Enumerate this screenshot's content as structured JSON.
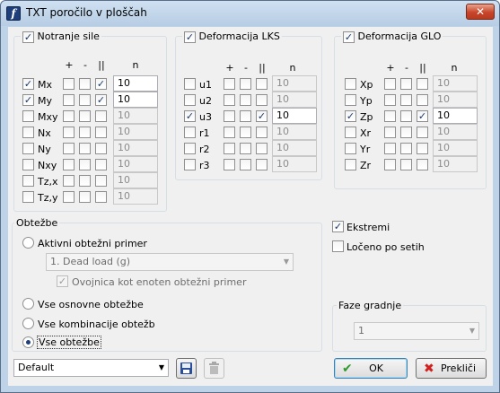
{
  "window": {
    "title": "TXT poročilo v ploščah",
    "close_glyph": "✕",
    "app_icon_glyph": "f"
  },
  "columns": {
    "plus": "+",
    "minus": "-",
    "abs": "||",
    "n": "n"
  },
  "notranje": {
    "label": "Notranje sile",
    "checked": true,
    "rows": [
      {
        "label": "Mx",
        "checked": true,
        "plus": false,
        "minus": false,
        "abs": true,
        "n": "10",
        "enabled": true
      },
      {
        "label": "My",
        "checked": true,
        "plus": false,
        "minus": false,
        "abs": true,
        "n": "10",
        "enabled": true
      },
      {
        "label": "Mxy",
        "checked": false,
        "plus": false,
        "minus": false,
        "abs": false,
        "n": "10",
        "enabled": false
      },
      {
        "label": "Nx",
        "checked": false,
        "plus": false,
        "minus": false,
        "abs": false,
        "n": "10",
        "enabled": false
      },
      {
        "label": "Ny",
        "checked": false,
        "plus": false,
        "minus": false,
        "abs": false,
        "n": "10",
        "enabled": false
      },
      {
        "label": "Nxy",
        "checked": false,
        "plus": false,
        "minus": false,
        "abs": false,
        "n": "10",
        "enabled": false
      },
      {
        "label": "Tz,x",
        "checked": false,
        "plus": false,
        "minus": false,
        "abs": false,
        "n": "10",
        "enabled": false
      },
      {
        "label": "Tz,y",
        "checked": false,
        "plus": false,
        "minus": false,
        "abs": false,
        "n": "10",
        "enabled": false
      }
    ]
  },
  "lks": {
    "label": "Deformacija LKS",
    "checked": true,
    "rows": [
      {
        "label": "u1",
        "checked": false,
        "plus": false,
        "minus": false,
        "abs": false,
        "n": "10",
        "enabled": false
      },
      {
        "label": "u2",
        "checked": false,
        "plus": false,
        "minus": false,
        "abs": false,
        "n": "10",
        "enabled": false
      },
      {
        "label": "u3",
        "checked": true,
        "plus": false,
        "minus": false,
        "abs": true,
        "n": "10",
        "enabled": true
      },
      {
        "label": "r1",
        "checked": false,
        "plus": false,
        "minus": false,
        "abs": false,
        "n": "10",
        "enabled": false
      },
      {
        "label": "r2",
        "checked": false,
        "plus": false,
        "minus": false,
        "abs": false,
        "n": "10",
        "enabled": false
      },
      {
        "label": "r3",
        "checked": false,
        "plus": false,
        "minus": false,
        "abs": false,
        "n": "10",
        "enabled": false
      }
    ]
  },
  "glo": {
    "label": "Deformacija GLO",
    "checked": true,
    "rows": [
      {
        "label": "Xp",
        "checked": false,
        "plus": false,
        "minus": false,
        "abs": false,
        "n": "10",
        "enabled": false
      },
      {
        "label": "Yp",
        "checked": false,
        "plus": false,
        "minus": false,
        "abs": false,
        "n": "10",
        "enabled": false
      },
      {
        "label": "Zp",
        "checked": true,
        "plus": false,
        "minus": false,
        "abs": true,
        "n": "10",
        "enabled": true
      },
      {
        "label": "Xr",
        "checked": false,
        "plus": false,
        "minus": false,
        "abs": false,
        "n": "10",
        "enabled": false
      },
      {
        "label": "Yr",
        "checked": false,
        "plus": false,
        "minus": false,
        "abs": false,
        "n": "10",
        "enabled": false
      },
      {
        "label": "Zr",
        "checked": false,
        "plus": false,
        "minus": false,
        "abs": false,
        "n": "10",
        "enabled": false
      }
    ]
  },
  "obtezbe": {
    "label": "Obtežbe",
    "aktivni_label": "Aktivni obtežni primer",
    "load_case_value": "1. Dead load (g)",
    "ovojnica_label": "Ovojnica kot enoten obtežni primer",
    "ovojnica_checked": true,
    "vse_osnovne_label": "Vse osnovne obtežbe",
    "vse_kombinacije_label": "Vse kombinacije obtežb",
    "vse_obtezbe_label": "Vse obtežbe",
    "selected": "vse_obtezbe"
  },
  "ekstremi": {
    "label": "Ekstremi",
    "checked": true
  },
  "loceno": {
    "label": "Ločeno po setih",
    "checked": false
  },
  "faze": {
    "label": "Faze gradnje",
    "value": "1"
  },
  "bottom": {
    "preset_value": "Default",
    "ok_label": "OK",
    "cancel_label": "Prekliči"
  },
  "colors": {
    "accent": "#1f3f7a",
    "ok_check": "#2e9a2e",
    "cancel_x": "#d22020",
    "save_icon": "#2a4e9a"
  }
}
